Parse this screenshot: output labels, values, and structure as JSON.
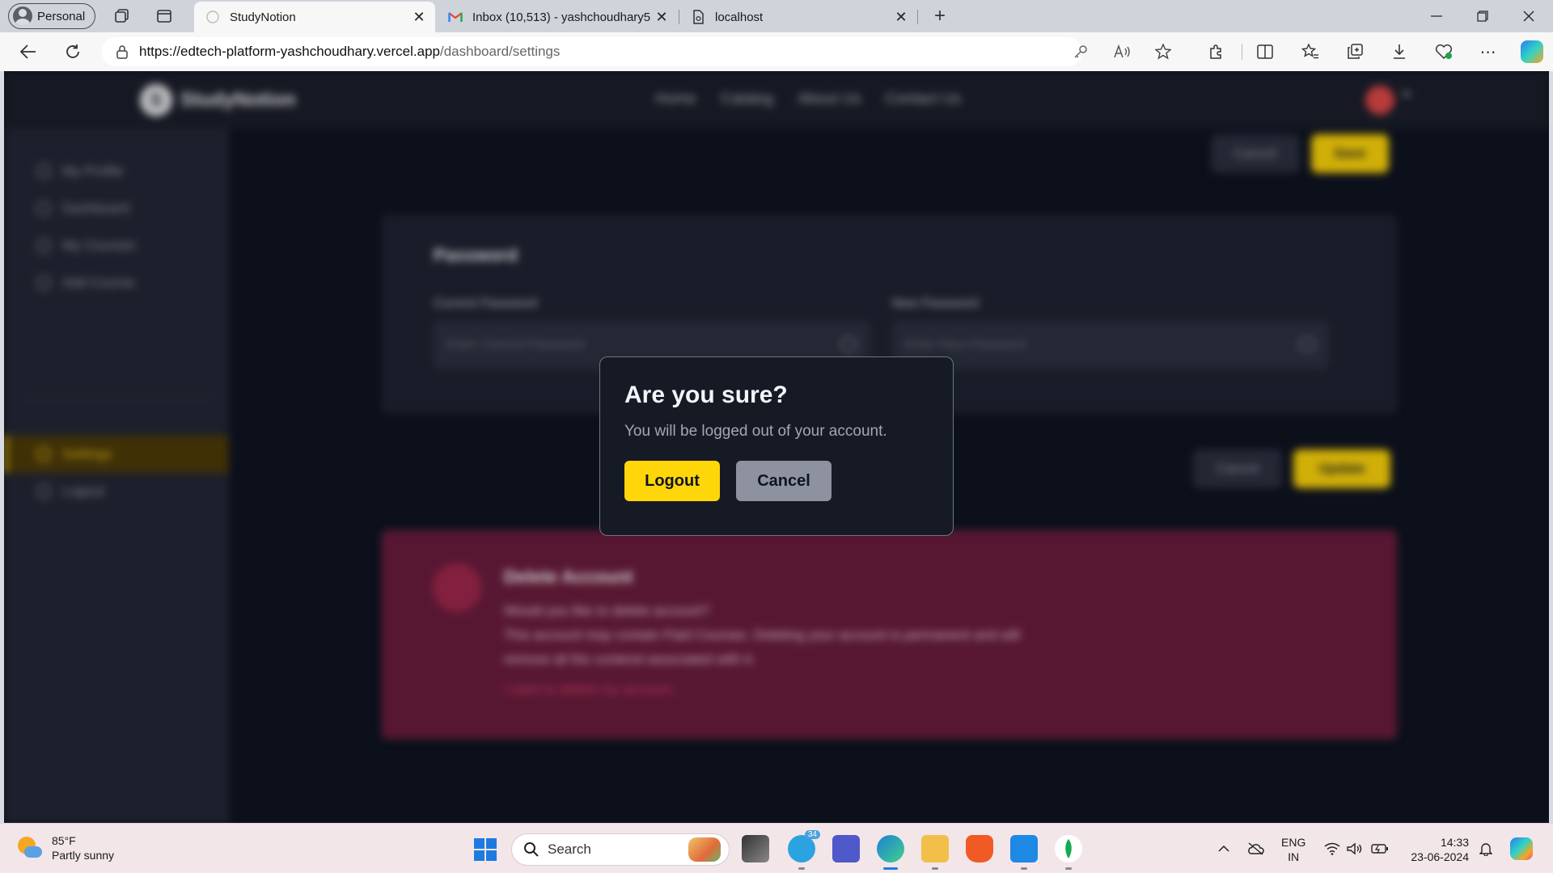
{
  "browser": {
    "profile_label": "Personal",
    "tabs": [
      {
        "title": "StudyNotion",
        "active": true
      },
      {
        "title": "Inbox (10,513) - yashchoudhary5",
        "active": false
      },
      {
        "title": "localhost",
        "active": false
      }
    ],
    "url_host": "https://edtech-platform-yashchoudhary.vercel.app",
    "url_path": "/dashboard/settings"
  },
  "site": {
    "brand": "StudyNotion",
    "nav_links": [
      "Home",
      "Catalog",
      "About Us",
      "Contact Us"
    ]
  },
  "sidebar": {
    "items": [
      "My Profile",
      "Dashboard",
      "My Courses",
      "Add Course"
    ],
    "settings": "Settings",
    "logout": "Logout"
  },
  "top_actions": {
    "cancel": "Cancel",
    "save": "Save"
  },
  "password_card": {
    "title": "Password",
    "current_label": "Current Password",
    "current_placeholder": "Enter Current Password",
    "new_label": "New Password",
    "new_placeholder": "Enter New Password"
  },
  "mid_actions": {
    "cancel": "Cancel",
    "update": "Update"
  },
  "delete_card": {
    "title": "Delete Account",
    "line1": "Would you like to delete account?",
    "line2": "This account may contain Paid Courses. Deleting your account is permanent and will remove all the contend associated with it.",
    "link": "I want to delete my account."
  },
  "modal": {
    "title": "Are you sure?",
    "text": "You will be logged out of your account.",
    "confirm": "Logout",
    "cancel": "Cancel"
  },
  "taskbar": {
    "temp": "85°F",
    "weather": "Partly sunny",
    "search": "Search",
    "telegram_badge": "34",
    "lang_1": "ENG",
    "lang_2": "IN",
    "time": "14:33",
    "date": "23-06-2024"
  },
  "colors": {
    "accent_yellow": "#ffd60a",
    "page_bg": "#0f1422",
    "danger_bg": "#6b1d3d"
  }
}
